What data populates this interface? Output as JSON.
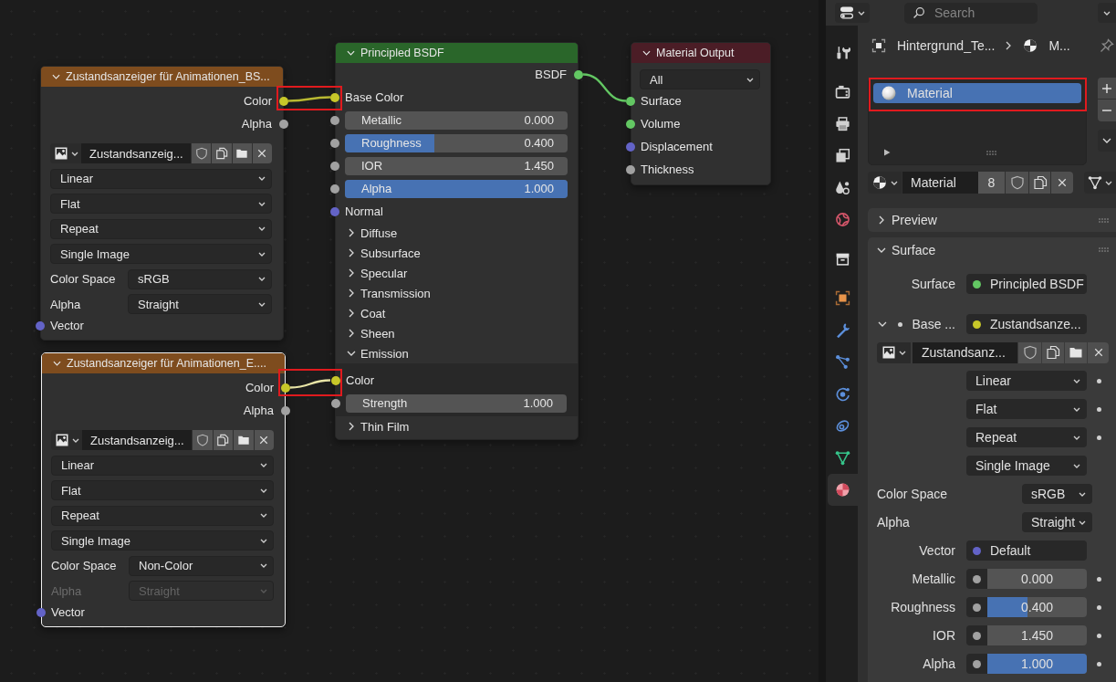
{
  "node_editor": {
    "nodes": [
      {
        "kind": "image_texture",
        "title": "Zustandsanzeiger für Animationen_BS...",
        "selected": false,
        "expanded": true,
        "outputs": [
          {
            "name": "Color",
            "color": "#c7c729"
          },
          {
            "name": "Alpha",
            "color": "#a1a1a1"
          }
        ],
        "image": "Zustandsanzeig...",
        "options": [
          "Linear",
          "Flat",
          "Repeat",
          "Single Image"
        ],
        "properties": [
          {
            "label": "Color Space",
            "value": "sRGB",
            "disabled": false
          },
          {
            "label": "Alpha",
            "value": "Straight",
            "disabled": false
          }
        ],
        "inputs": [
          {
            "kind": "socket",
            "name": "Vector",
            "color": "#6363c7"
          }
        ]
      },
      {
        "kind": "image_texture",
        "title": "Zustandsanzeiger für Animationen_E....",
        "selected": true,
        "expanded": true,
        "outputs": [
          {
            "name": "Color",
            "color": "#c7c729"
          },
          {
            "name": "Alpha",
            "color": "#a1a1a1"
          }
        ],
        "image": "Zustandsanzeig...",
        "options": [
          "Linear",
          "Flat",
          "Repeat",
          "Single Image"
        ],
        "properties": [
          {
            "label": "Color Space",
            "value": "Non-Color",
            "disabled": false
          },
          {
            "label": "Alpha",
            "value": "Straight",
            "disabled": true
          }
        ],
        "inputs": [
          {
            "kind": "socket",
            "name": "Vector",
            "color": "#6363c7"
          }
        ]
      },
      {
        "kind": "principled_bsdf",
        "title": "Principled BSDF",
        "selected": false,
        "expanded": true,
        "outputs": [
          {
            "name": "BSDF",
            "color": "#63c763"
          }
        ],
        "inputs": [
          {
            "kind": "socket",
            "name": "Base Color",
            "color": "#c7c729"
          },
          {
            "kind": "number",
            "name": "Metallic",
            "value": "0.000",
            "color": "#a1a1a1"
          },
          {
            "kind": "slider",
            "name": "Roughness",
            "value": "0.400",
            "level": 0.4,
            "color": "#a1a1a1"
          },
          {
            "kind": "number",
            "name": "IOR",
            "value": "1.450",
            "color": "#a1a1a1"
          },
          {
            "kind": "slider",
            "name": "Alpha",
            "value": "1.000",
            "level": 1,
            "color": "#a1a1a1"
          },
          {
            "kind": "socket",
            "name": "Normal",
            "color": "#6363c7"
          }
        ],
        "panels": [
          {
            "name": "Diffuse",
            "expanded": false
          },
          {
            "name": "Subsurface",
            "expanded": false
          },
          {
            "name": "Specular",
            "expanded": false
          },
          {
            "name": "Transmission",
            "expanded": false
          },
          {
            "name": "Coat",
            "expanded": false
          },
          {
            "name": "Sheen",
            "expanded": false
          },
          {
            "name": "Emission",
            "expanded": true,
            "inputs": [
              {
                "kind": "socket",
                "name": "Color",
                "color": "#c7c729"
              },
              {
                "kind": "number",
                "name": "Strength",
                "value": "1.000",
                "color": "#a1a1a1"
              }
            ]
          },
          {
            "name": "Thin Film",
            "expanded": false
          }
        ]
      },
      {
        "kind": "material_output",
        "title": "Material Output",
        "selected": false,
        "expanded": true,
        "target": "All",
        "inputs": [
          {
            "kind": "socket",
            "name": "Surface",
            "color": "#63c763"
          },
          {
            "kind": "socket",
            "name": "Volume",
            "color": "#63c763"
          },
          {
            "kind": "socket",
            "name": "Displacement",
            "color": "#6363c7"
          },
          {
            "kind": "socket",
            "name": "Thickness",
            "color": "#a1a1a1"
          }
        ]
      }
    ],
    "links": [
      {
        "color": "#b9b932",
        "highlighted": true
      },
      {
        "color": "#e8e4a6",
        "highlighted": true
      },
      {
        "color": "#63c763",
        "highlighted": false
      }
    ]
  },
  "properties_editor": {
    "search": {
      "placeholder": "Search"
    },
    "tab_groups": [
      {
        "tabs": [
          {
            "kind": "tool",
            "selected": false
          }
        ]
      },
      {
        "tabs": [
          {
            "kind": "render",
            "selected": false
          },
          {
            "kind": "output",
            "selected": false
          },
          {
            "kind": "viewlayer",
            "selected": false
          },
          {
            "kind": "scene",
            "selected": false
          },
          {
            "kind": "world",
            "selected": false
          }
        ]
      },
      {
        "tabs": [
          {
            "kind": "collection",
            "selected": false
          }
        ]
      },
      {
        "tabs": [
          {
            "kind": "object",
            "selected": false
          },
          {
            "kind": "modifiers",
            "selected": false
          },
          {
            "kind": "particles",
            "selected": false
          },
          {
            "kind": "physics",
            "selected": false
          },
          {
            "kind": "constraints",
            "selected": false
          },
          {
            "kind": "data",
            "selected": false
          },
          {
            "kind": "material",
            "selected": true
          }
        ]
      }
    ],
    "breadcrumb": [
      {
        "kind": "object",
        "label": "Hintergrund_Te..."
      },
      {
        "kind": "material",
        "label": "M..."
      }
    ],
    "material_slots": [
      {
        "name": "Material",
        "selected": true,
        "highlighted": true
      }
    ],
    "material": {
      "name": "Material",
      "users": "8"
    },
    "panels": [
      {
        "title": "Preview",
        "expanded": false
      },
      {
        "title": "Surface",
        "expanded": true,
        "rows": [
          {
            "kind": "link",
            "label": "Surface",
            "value": "Principled BSDF",
            "color": "#63c763",
            "animatable": false
          },
          {
            "kind": "group",
            "label": "Base ...",
            "value": "Zustandsanze...",
            "color": "#c7c729",
            "expanded": true,
            "animatable": false,
            "children": [
              {
                "kind": "image",
                "value": "Zustandsanz..."
              },
              {
                "kind": "dropdown",
                "value": "Linear",
                "animatable": true
              },
              {
                "kind": "dropdown",
                "value": "Flat",
                "animatable": true
              },
              {
                "kind": "dropdown",
                "value": "Repeat",
                "animatable": true
              },
              {
                "kind": "dropdown",
                "value": "Single Image",
                "animatable": false
              },
              {
                "kind": "property",
                "label": "Color Space",
                "value": "sRGB",
                "animatable": false
              },
              {
                "kind": "property",
                "label": "Alpha",
                "value": "Straight",
                "animatable": false
              },
              {
                "kind": "link",
                "label": "Vector",
                "value": "Default",
                "color": "#6363c7",
                "animatable": false
              }
            ]
          },
          {
            "kind": "number",
            "label": "Metallic",
            "value": "0.000",
            "color": "#a1a1a1",
            "animatable": true
          },
          {
            "kind": "slider",
            "label": "Roughness",
            "value": "0.400",
            "level": 0.4,
            "color": "#a1a1a1",
            "animatable": true
          },
          {
            "kind": "number",
            "label": "IOR",
            "value": "1.450",
            "color": "#a1a1a1",
            "animatable": true
          },
          {
            "kind": "slider",
            "label": "Alpha",
            "value": "1.000",
            "level": 1,
            "color": "#a1a1a1",
            "animatable": true
          }
        ]
      }
    ]
  }
}
